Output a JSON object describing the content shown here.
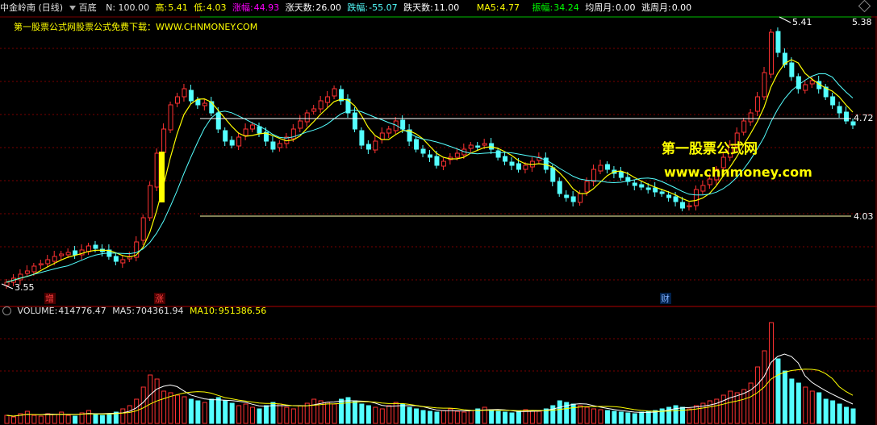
{
  "header": {
    "stock_name": "中金岭南 (日线)",
    "indicator": "百底",
    "n_label": "N: 100.00",
    "high_label": "高:",
    "high_value": "5.41",
    "low_label": "低:",
    "low_value": "4.03",
    "rise_label": "涨幅:",
    "rise_value": "44.93",
    "up_days_label": "涨天数:",
    "up_days_value": "26.00",
    "fall_label": "跌幅:",
    "fall_value": "-55.07",
    "down_days_label": "跌天数:",
    "down_days_value": "11.00",
    "ma5_label": "MA5:",
    "ma5_value": "4.77",
    "amp_label": "振幅:",
    "amp_value": "34.24",
    "avg_week_label": "均周月:",
    "avg_week_value": "0.00",
    "escape_week_label": "逃周月:",
    "escape_week_value": "0.00"
  },
  "subtitle": "第一股票公式网股票公式免费下载：WWW.CHNMONEY.COM",
  "watermark": {
    "line1": "第一股票公式网",
    "line2": "www.chnmoney.com"
  },
  "price_labels": {
    "top_right": "5.38",
    "peak": "5.41",
    "resistance": "4.72",
    "support": "4.03",
    "low": "3.55"
  },
  "markers": {
    "m1": "增",
    "m2": "涨",
    "m3": "财"
  },
  "volume_header": {
    "label": "VOLUME:",
    "value": "414776.47",
    "ma5_label": "MA5:",
    "ma5_value": "704361.94",
    "ma10_label": "MA10:",
    "ma10_value": "951386.56"
  },
  "colors": {
    "up": "#ff3232",
    "down": "#54ffff",
    "ma": "#ffff00",
    "ma2": "#ffffff",
    "grid": "#7a0000"
  },
  "icons": {
    "diamond": "diamond-icon",
    "menu": "dropdown-triangle-icon"
  }
}
